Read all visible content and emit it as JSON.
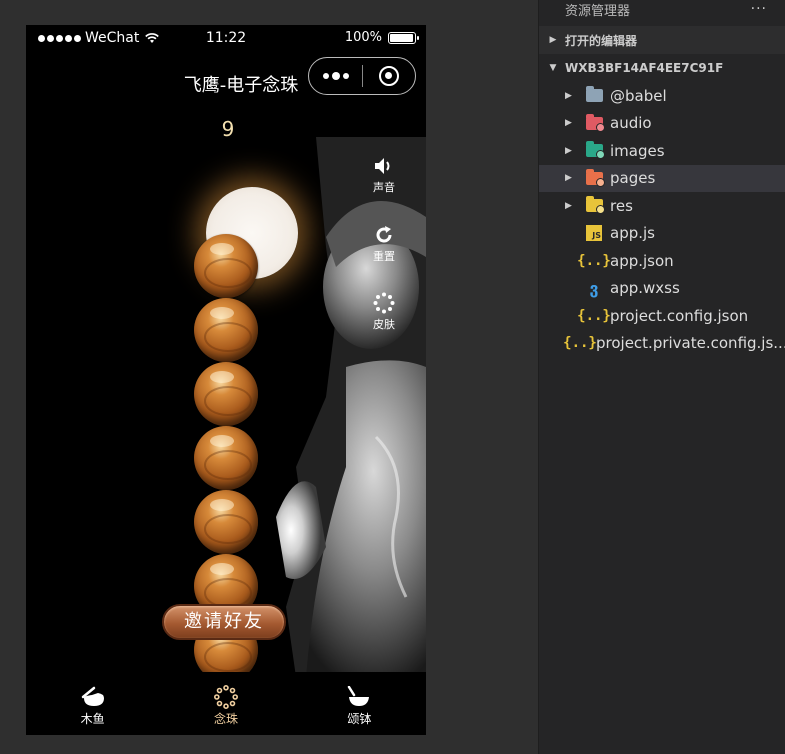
{
  "status_bar": {
    "carrier": "WeChat",
    "time": "11:22",
    "battery": "100%",
    "battery_level": 100
  },
  "navbar": {
    "title": "飞鹰-电子念珠"
  },
  "counter": "9",
  "side_controls": [
    {
      "label": "声音",
      "icon": "speaker-icon"
    },
    {
      "label": "重置",
      "icon": "refresh-icon"
    },
    {
      "label": "皮肤",
      "icon": "skin-ring-icon"
    }
  ],
  "invite_button": "邀请好友",
  "tabs": [
    {
      "label": "木鱼",
      "icon": "wooden-fish-icon",
      "active": false
    },
    {
      "label": "念珠",
      "icon": "prayer-beads-icon",
      "active": true
    },
    {
      "label": "颂钵",
      "icon": "singing-bowl-icon",
      "active": false
    }
  ],
  "explorer": {
    "title": "资源管理器",
    "more": "···",
    "open_editors": "打开的编辑器",
    "project": "WXB3BF14AF4EE7C91F",
    "items": [
      {
        "name": "@babel",
        "type": "folder",
        "color": "#8ea3b5"
      },
      {
        "name": "audio",
        "type": "folder",
        "color": "#e05a63"
      },
      {
        "name": "images",
        "type": "folder",
        "color": "#2aa889"
      },
      {
        "name": "pages",
        "type": "folder",
        "color": "#e8704a"
      },
      {
        "name": "res",
        "type": "folder",
        "color": "#e8c43a"
      },
      {
        "name": "app.js",
        "type": "js"
      },
      {
        "name": "app.json",
        "type": "json"
      },
      {
        "name": "app.wxss",
        "type": "css"
      },
      {
        "name": "project.config.json",
        "type": "json"
      },
      {
        "name": "project.private.config.js...",
        "type": "json"
      }
    ],
    "selected": "pages"
  },
  "colors": {
    "explorer_bg": "#252526",
    "bead": "#a85a1c",
    "active_tab": "#f0cfa0"
  }
}
